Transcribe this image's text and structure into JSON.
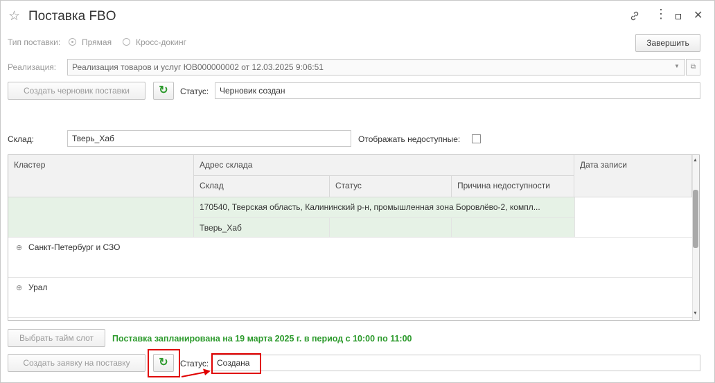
{
  "window": {
    "title": "Поставка FBO",
    "icons": [
      "star-icon",
      "link-icon",
      "more-icon",
      "maximize-icon",
      "close-icon"
    ]
  },
  "supply_type": {
    "label": "Тип поставки:",
    "options": [
      {
        "label": "Прямая",
        "selected": true
      },
      {
        "label": "Кросс-докинг",
        "selected": false
      }
    ]
  },
  "finish_button": "Завершить",
  "realization": {
    "label": "Реализация:",
    "value": "Реализация товаров и услуг ЮВ000000002 от 12.03.2025 9:06:51"
  },
  "draft": {
    "button": "Создать черновик поставки",
    "status_label": "Статус:",
    "status_value": "Черновик создан"
  },
  "warehouse": {
    "label": "Склад:",
    "value": "Тверь_Хаб",
    "show_unavailable_label": "Отображать недоступные:"
  },
  "table": {
    "columns": {
      "cluster": "Кластер",
      "address": "Адрес склада",
      "date": "Дата записи",
      "sub_warehouse": "Склад",
      "sub_status": "Статус",
      "sub_reason": "Причина недоступности"
    },
    "selected_row": {
      "address": "170540, Тверская область, Калининский р-н, промышленная зона Боровлёво-2, компл...",
      "warehouse": "Тверь_Хаб"
    },
    "groups": [
      "Санкт-Петербург и СЗО",
      "Урал"
    ]
  },
  "timeslot": {
    "button": "Выбрать тайм слот",
    "message": "Поставка запланирована на 19 марта 2025 г. в период с 10:00 по 11:00"
  },
  "request": {
    "button": "Создать заявку на поставку",
    "status_label": "Статус:",
    "status_value": "Создана"
  },
  "colors": {
    "accent_green": "#2c9a2c",
    "highlight_red": "#e00000",
    "selected_row": "#e6f2e6"
  }
}
